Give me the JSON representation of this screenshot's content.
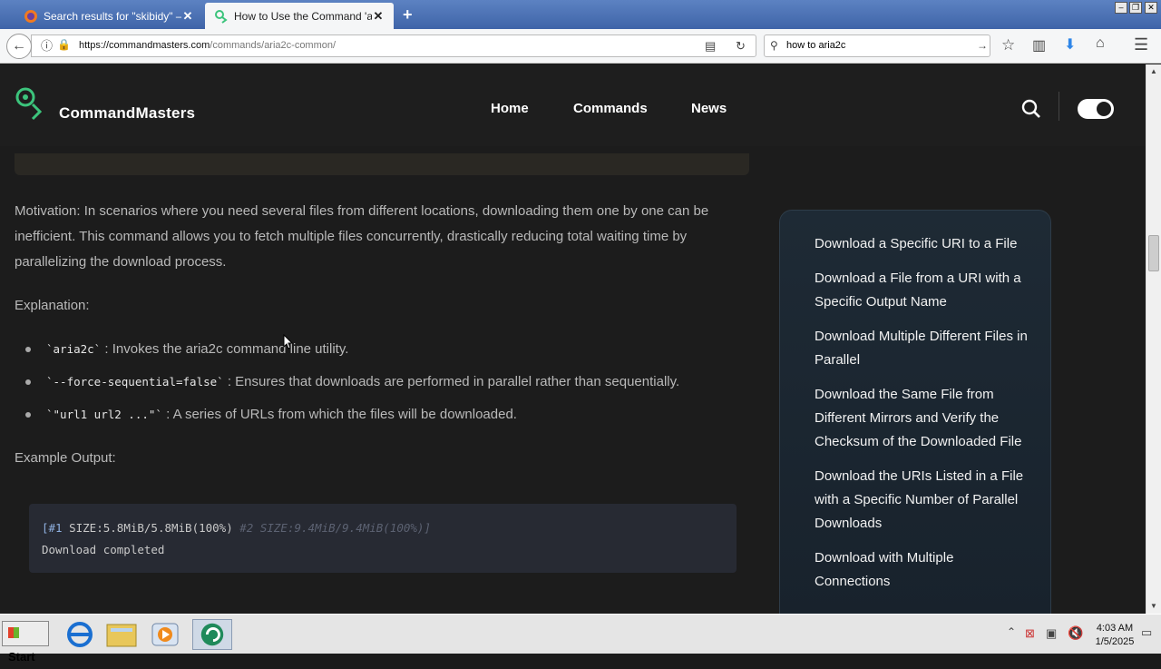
{
  "browser": {
    "tabs": [
      {
        "title": "Search results for \"skibidy\" – A",
        "close": "✕"
      },
      {
        "title": "How to Use the Command 'aria",
        "close": "✕"
      }
    ],
    "new_tab": "+",
    "url_host": "https://commandmasters.com",
    "url_path": "/commands/aria2c-common/",
    "search_value": "how to aria2c"
  },
  "site": {
    "logo_text": "CommandMasters",
    "nav": [
      "Home",
      "Commands",
      "News"
    ]
  },
  "content": {
    "motivation": "Motivation: In scenarios where you need several files from different locations, downloading them one by one can be inefficient. This command allows you to fetch multiple files concurrently, drastically reducing total waiting time by parallelizing the download process.",
    "explanation_label": "Explanation:",
    "bullets": [
      {
        "code": "`aria2c`",
        "text": " : Invokes the aria2c command line utility."
      },
      {
        "code": "`--force-sequential=false`",
        "text": " : Ensures that downloads are performed in parallel rather than sequentially."
      },
      {
        "code": "`\"url1 url2 ...\"`",
        "text": " : A series of URLs from which the files will be downloaded."
      }
    ],
    "example_label": "Example Output:",
    "output": {
      "line1_a": "[#1 ",
      "line1_b": "SIZE:5.8MiB/5.8MiB(100%)",
      "line1_c": " #2 SIZE:9.4MiB/9.4MiB(100%)]",
      "line2": "Download completed"
    }
  },
  "toc": [
    "Download a Specific URI to a File",
    "Download a File from a URI with a Specific Output Name",
    "Download Multiple Different Files in Parallel",
    "Download the Same File from Different Mirrors and Verify the Checksum of the Downloaded File",
    "Download the URIs Listed in a File with a Specific Number of Parallel Downloads",
    "Download with Multiple Connections"
  ],
  "taskbar": {
    "start": "Start",
    "time": "4:03 AM",
    "date": "1/5/2025"
  },
  "colors": {
    "accent_green": "#3cc47c",
    "page_bg": "#1c1c1c",
    "toc_bg": "#1e2a35"
  }
}
